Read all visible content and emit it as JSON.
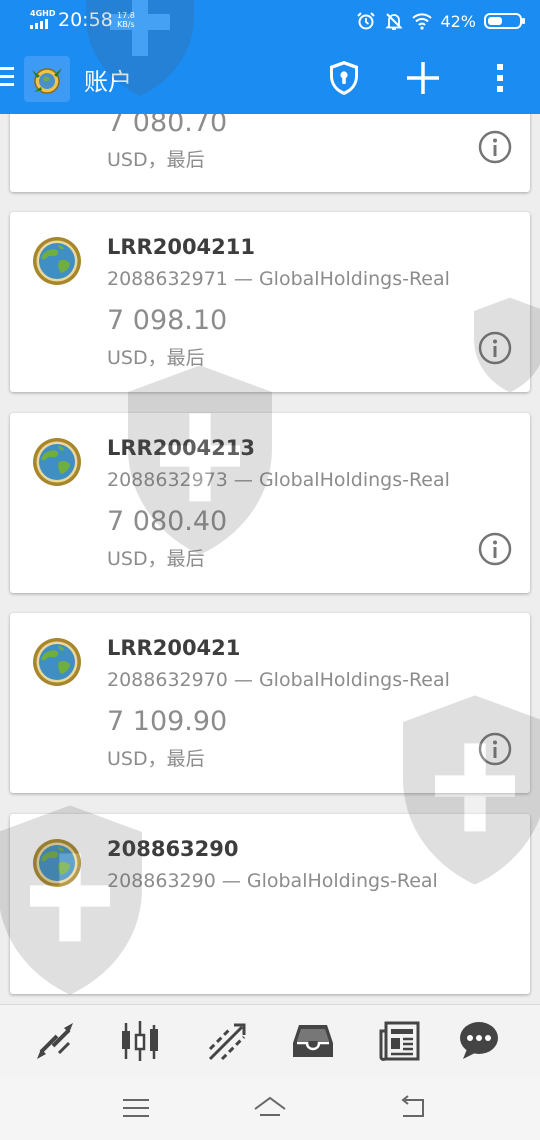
{
  "status_bar": {
    "network": "4GHD",
    "time": "20:58",
    "speed_value": "17.8",
    "speed_unit": "KB/s",
    "battery": "42%"
  },
  "app_bar": {
    "title": "账户",
    "icons": [
      "menu-icon",
      "app-logo",
      "shield-lock-icon",
      "plus-icon",
      "more-vert-icon"
    ]
  },
  "accounts": [
    {
      "name": "",
      "server": "",
      "balance": "7 080.70",
      "currency": "USD，最后"
    },
    {
      "name": "LRR2004211",
      "server": "2088632971 — GlobalHoldings-Real",
      "balance": "7 098.10",
      "currency": "USD，最后"
    },
    {
      "name": "LRR2004213",
      "server": "2088632973 — GlobalHoldings-Real",
      "balance": "7 080.40",
      "currency": "USD，最后"
    },
    {
      "name": "LRR200421",
      "server": "2088632970 — GlobalHoldings-Real",
      "balance": "7 109.90",
      "currency": "USD，最后"
    },
    {
      "name": "208863290",
      "server": "208863290 — GlobalHoldings-Real",
      "balance": "",
      "currency": ""
    }
  ],
  "toolbar": {
    "icons": [
      "quotes-icon",
      "chart-icon",
      "trade-icon",
      "history-icon",
      "news-icon",
      "chat-icon"
    ]
  },
  "nav_bar": {
    "icons": [
      "menu-lines-icon",
      "home-icon",
      "back-icon"
    ]
  },
  "colors": {
    "primary": "#1a8cf2",
    "text_dark": "#3d3d3d",
    "text_gray": "#8c8c8c",
    "icon_gray": "#444444"
  }
}
